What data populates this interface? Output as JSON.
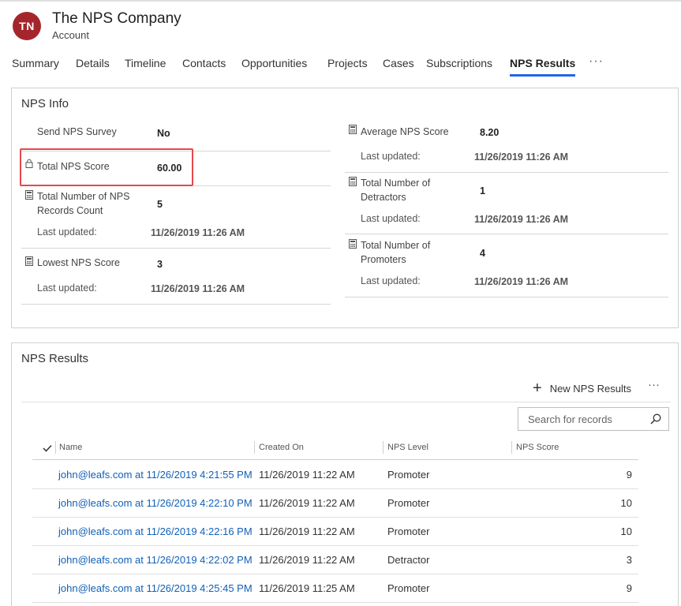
{
  "header": {
    "avatar_initials": "TN",
    "avatar_color": "#a4262c",
    "title": "The NPS Company",
    "entity": "Account"
  },
  "tabs": [
    {
      "label": "Summary"
    },
    {
      "label": "Details"
    },
    {
      "label": "Timeline"
    },
    {
      "label": "Contacts"
    },
    {
      "label": "Opportunities"
    },
    {
      "label": "Projects"
    },
    {
      "label": "Cases"
    },
    {
      "label": "Subscriptions"
    },
    {
      "label": "NPS Results",
      "active": true
    }
  ],
  "tab_more_label": "···",
  "nps_info": {
    "title": "NPS Info",
    "send_survey": {
      "label": "Send NPS Survey",
      "value": "No"
    },
    "total_score": {
      "label": "Total NPS Score",
      "value": "60.00"
    },
    "records_count": {
      "label_line1": "Total Number of NPS",
      "label_line2": "Records Count",
      "value": "5",
      "updated_label": "Last updated:",
      "updated_value": "11/26/2019 11:26 AM"
    },
    "lowest_score": {
      "label": "Lowest NPS Score",
      "value": "3",
      "updated_label": "Last updated:",
      "updated_value": "11/26/2019 11:26 AM"
    },
    "average_score": {
      "label": "Average NPS Score",
      "value": "8.20",
      "updated_label": "Last updated:",
      "updated_value": "11/26/2019 11:26 AM"
    },
    "detractors": {
      "label_line1": "Total Number of",
      "label_line2": "Detractors",
      "value": "1",
      "updated_label": "Last updated:",
      "updated_value": "11/26/2019 11:26 AM"
    },
    "promoters": {
      "label_line1": "Total Number of",
      "label_line2": "Promoters",
      "value": "4",
      "updated_label": "Last updated:",
      "updated_value": "11/26/2019 11:26 AM"
    }
  },
  "nps_results": {
    "title": "NPS Results",
    "new_button_label": "New NPS Results",
    "more_label": "···",
    "search_placeholder": "Search for records",
    "columns": [
      "Name",
      "Created On",
      "NPS Level",
      "NPS Score"
    ],
    "rows": [
      {
        "name": "john@leafs.com at 11/26/2019 4:21:55 PM",
        "created_on": "11/26/2019 11:22 AM",
        "level": "Promoter",
        "score": "9"
      },
      {
        "name": "john@leafs.com at 11/26/2019 4:22:10 PM",
        "created_on": "11/26/2019 11:22 AM",
        "level": "Promoter",
        "score": "10"
      },
      {
        "name": "john@leafs.com at 11/26/2019 4:22:16 PM",
        "created_on": "11/26/2019 11:22 AM",
        "level": "Promoter",
        "score": "10"
      },
      {
        "name": "john@leafs.com at 11/26/2019 4:22:02 PM",
        "created_on": "11/26/2019 11:22 AM",
        "level": "Detractor",
        "score": "3"
      },
      {
        "name": "john@leafs.com at 11/26/2019 4:25:45 PM",
        "created_on": "11/26/2019 11:25 AM",
        "level": "Promoter",
        "score": "9"
      }
    ]
  },
  "colors": {
    "accent": "#2266e3",
    "link": "#1160b7",
    "highlight": "#e5484d"
  }
}
